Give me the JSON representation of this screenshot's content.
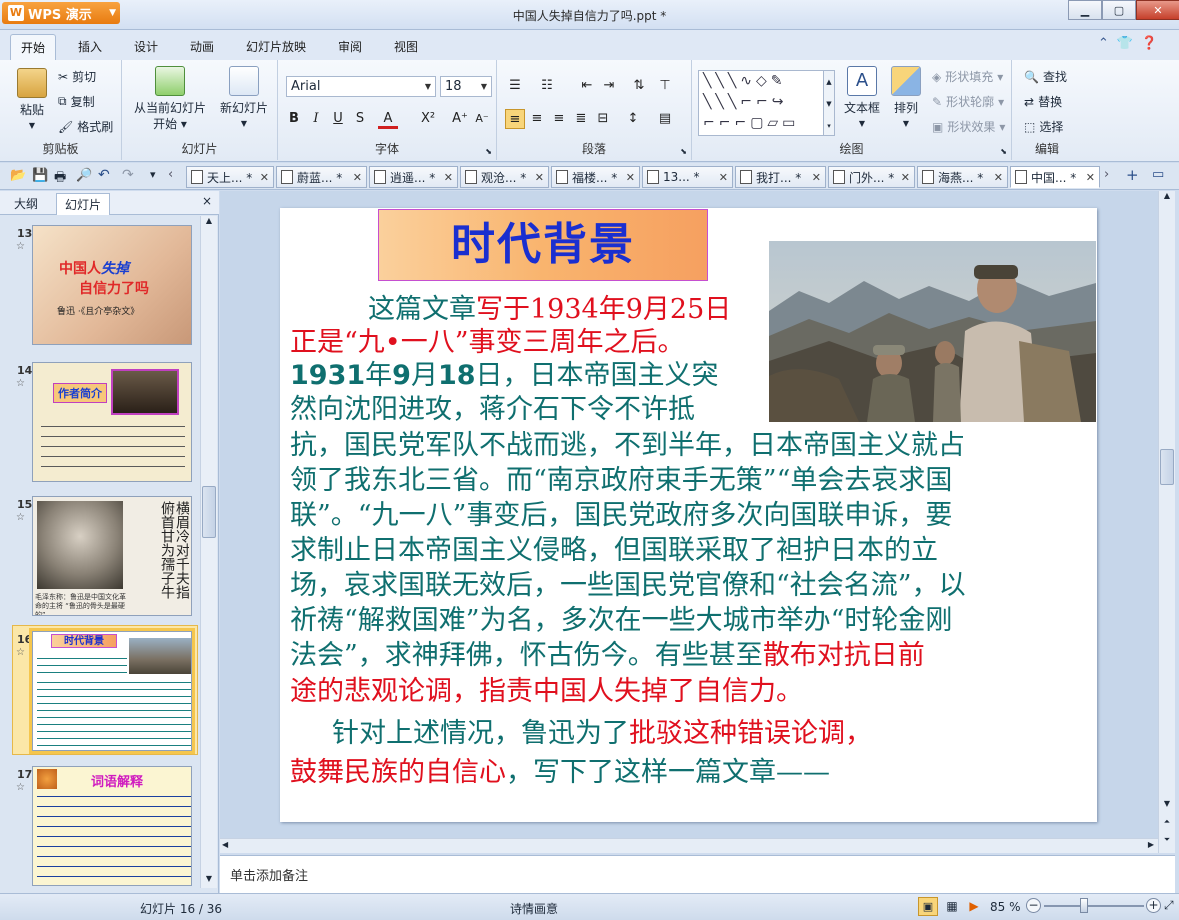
{
  "app": {
    "name": "WPS 演示",
    "window_title": "中国人失掉自信力了吗.ppt *"
  },
  "ribbon_tabs": [
    "开始",
    "插入",
    "设计",
    "动画",
    "幻灯片放映",
    "审阅",
    "视图"
  ],
  "clipboard": {
    "paste": "粘贴",
    "cut": "剪切",
    "copy": "复制",
    "format_painter": "格式刷",
    "group": "剪贴板"
  },
  "slides_group": {
    "from_current": "从当前幻灯片",
    "from_current2": "开始",
    "new_slide": "新幻灯片",
    "group": "幻灯片"
  },
  "font": {
    "family": "Arial",
    "size": "18",
    "group": "字体",
    "bold": "B",
    "italic": "I",
    "underline": "U",
    "strike": "S",
    "color": "A",
    "superscript": "X²",
    "grow": "A⁺",
    "shrink": "A⁻"
  },
  "paragraph": {
    "group": "段落"
  },
  "drawing": {
    "textbox": "文本框",
    "arrange": "排列",
    "shape_fill": "形状填充",
    "shape_outline": "形状轮廓",
    "shape_effect": "形状效果",
    "group": "绘图"
  },
  "editing": {
    "find": "查找",
    "replace": "替换",
    "select": "选择",
    "group": "编辑"
  },
  "doc_tabs": [
    {
      "label": "天上... *"
    },
    {
      "label": "蔚蓝... *"
    },
    {
      "label": "逍遥... *"
    },
    {
      "label": "观沧... *"
    },
    {
      "label": "福楼... *"
    },
    {
      "label": "13... *"
    },
    {
      "label": "我打... *"
    },
    {
      "label": "门外... *"
    },
    {
      "label": "海燕... *"
    },
    {
      "label": "中国... *"
    }
  ],
  "left_pane": {
    "tab_outline": "大纲",
    "tab_slides": "幻灯片",
    "close": "×"
  },
  "thumbnails": [
    {
      "no": "13",
      "line1": "中国人",
      "line1b": "失掉",
      "line2": "自信力了吗",
      "line3": "鲁迅 ·《且介亭杂文》"
    },
    {
      "no": "14",
      "title": "作者简介"
    },
    {
      "no": "15",
      "caption": "毛泽东称：鲁迅是中国文化革命的主将 “鲁迅的骨头是最硬的”",
      "calli": "横眉冷对千夫指 俯首甘为孺子牛"
    },
    {
      "no": "16",
      "title": "时代背景"
    },
    {
      "no": "17",
      "title": "词语解释"
    }
  ],
  "slide": {
    "title": "时代背景",
    "p1a": "这篇文章",
    "p1b": "写于1934年9月25日",
    "p2": "正是“九•一八”事变三周年之后。",
    "p3a": "1931",
    "p3b": "年",
    "p3c": "9",
    "p3d": "月",
    "p3e": "18",
    "p3f": "日，日本帝国主义突",
    "p4": "然向沈阳进攻，蒋介石下令不许抵",
    "p5": "抗，国民党军队不战而逃，不到半年，日本帝国主义就占",
    "p6": "领了我东北三省。而“南京政府束手无策”“单会去哀求国",
    "p7": "联”。“九一八”事变后，国民党政府多次向国联申诉，要",
    "p8": "求制止日本帝国主义侵略，但国联采取了袒护日本的立",
    "p9": "场，哀求国联无效后，一些国民党官僚和“社会名流”，以",
    "p10": "祈祷“解救国难”为名，多次在一些大城市举办“时轮金刚",
    "p11a": "法会”，求神拜佛，怀古伤今。有些甚至",
    "p11b": "散布对抗日前",
    "p12": "途的悲观论调，指责中国人失掉了自信力。",
    "p13a": "针对上述情况，鲁迅为了",
    "p13b": "批驳这种错误论调，",
    "p14a": "鼓舞民族的自信心",
    "p14b": "，写下了这样一篇文章——"
  },
  "notes_placeholder": "单击添加备注",
  "status": {
    "slide_count": "幻灯片 16 / 36",
    "theme": "诗情画意",
    "zoom": "85 %"
  }
}
